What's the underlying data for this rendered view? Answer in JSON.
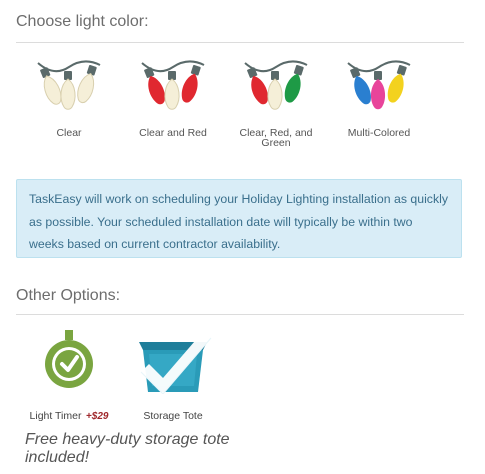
{
  "light_color": {
    "title": "Choose light color:",
    "options": [
      {
        "label": "Clear",
        "icon": "clear-lights-icon"
      },
      {
        "label": "Clear and Red",
        "icon": "clear-red-lights-icon"
      },
      {
        "label": "Clear, Red, and Green",
        "icon": "clear-red-green-lights-icon"
      },
      {
        "label": "Multi-Colored",
        "icon": "multicolor-lights-icon"
      }
    ]
  },
  "notice": {
    "text": "TaskEasy will work on scheduling your Holiday Lighting installation as quickly as possible. Your scheduled installation date will typically be within two weeks based on current contractor availability."
  },
  "other_options": {
    "title": "Other Options:",
    "items": [
      {
        "label": "Light Timer",
        "price": "+$29",
        "icon": "timer-icon"
      },
      {
        "label": "Storage Tote",
        "icon": "storage-tote-icon"
      }
    ],
    "promo": "Free heavy-duty storage tote included!"
  },
  "colors": {
    "clear": "#f5efd8",
    "red": "#e02830",
    "green": "#1e9a46",
    "blue": "#2a7fd0",
    "pink": "#e8449a",
    "yellow": "#f3d21e",
    "socket": "#5a6a6a",
    "timer_green": "#7aa540",
    "tote_teal": "#2a9bb8",
    "info_bg": "#d9edf7",
    "info_text": "#3a6f8c",
    "price_red": "#a0282c"
  }
}
